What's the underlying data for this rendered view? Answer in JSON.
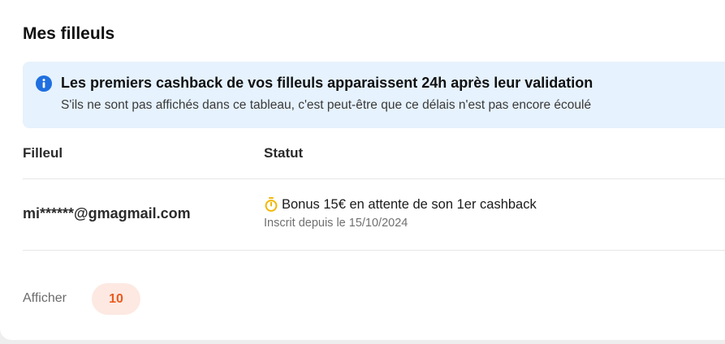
{
  "section": {
    "title": "Mes filleuls"
  },
  "info": {
    "icon": "info-circle-icon",
    "accent": "#1f6fe0",
    "background": "#e6f2fd",
    "title": "Les premiers cashback de vos filleuls apparaissent 24h après leur validation",
    "subtitle": "S'ils ne sont pas affichés dans ce tableau, c'est peut-être que ce délais n'est pas encore écoulé"
  },
  "table": {
    "columns": [
      "Filleul",
      "Statut"
    ],
    "rows": [
      {
        "filleul": "mi******@gmagmail.com",
        "status_icon": "stopwatch-icon",
        "status_icon_color": "#f2b705",
        "status": "Bonus 15€ en attente de son 1er cashback",
        "status_detail": "Inscrit depuis le 15/10/2024"
      }
    ]
  },
  "pagination": {
    "show_label": "Afficher",
    "page_size": "10",
    "accent": "#ec5a1f"
  }
}
